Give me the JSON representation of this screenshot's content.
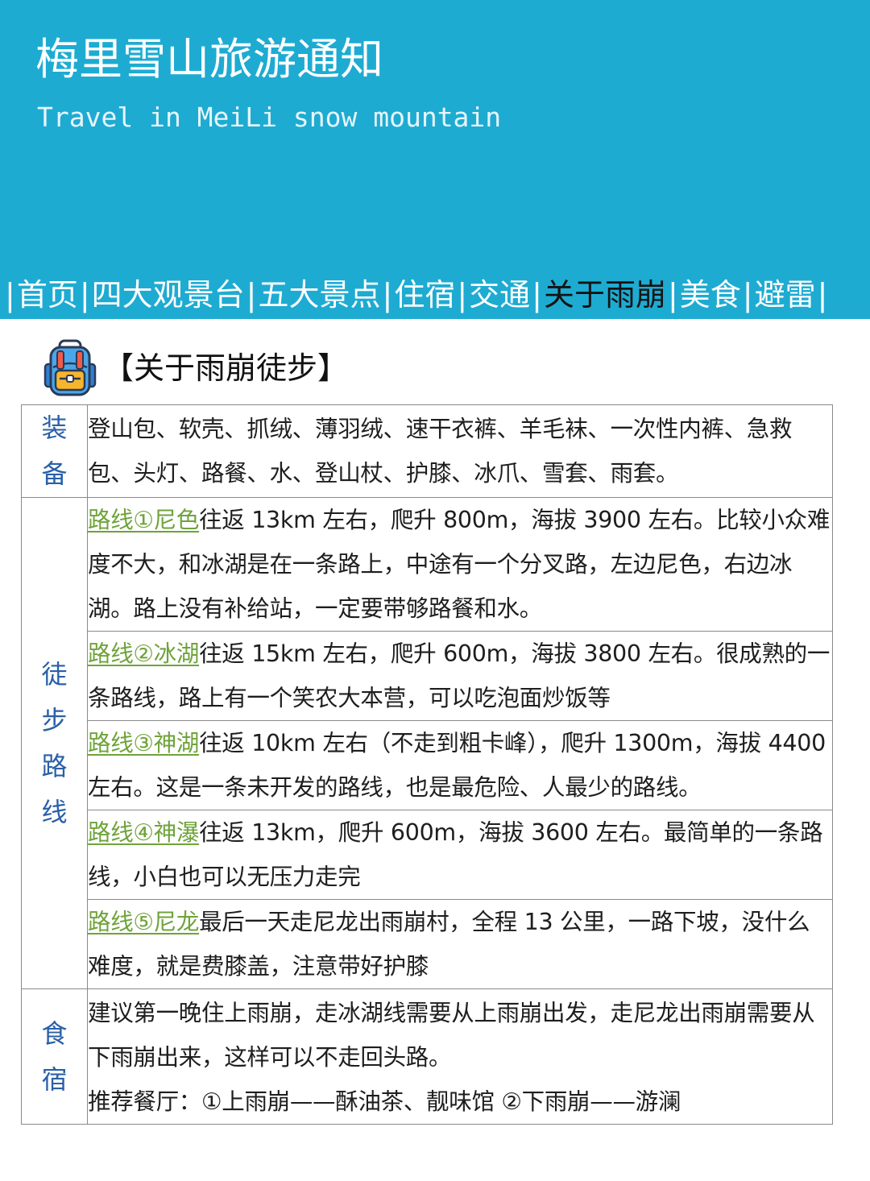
{
  "header": {
    "title": "梅里雪山旅游通知",
    "subtitle": "Travel in MeiLi snow mountain"
  },
  "nav": {
    "separator": "|",
    "items": [
      "首页",
      "四大观景台",
      "五大景点",
      "住宿",
      "交通",
      "关于雨崩",
      "美食",
      "避雷"
    ],
    "active": "关于雨崩",
    "colors": {
      "banner": "#1eabd2",
      "text": "#ffffff",
      "active": "#141414"
    }
  },
  "section": {
    "icon": "backpack-icon",
    "title": "【关于雨崩徒步】"
  },
  "table": {
    "equipment": {
      "label": [
        "装",
        "备"
      ],
      "text": "登山包、软壳、抓绒、薄羽绒、速干衣裤、羊毛袜、一次性内裤、急救包、头灯、路餐、水、登山杖、护膝、冰爪、雪套、雨套。"
    },
    "routes": {
      "label": [
        "徒",
        "步",
        "路",
        "线"
      ],
      "items": [
        {
          "tag": "路线①尼色",
          "text": "往返 13km 左右，爬升 800m，海拔 3900 左右。比较小众难度不大，和冰湖是在一条路上，中途有一个分叉路，左边尼色，右边冰湖。路上没有补给站，一定要带够路餐和水。"
        },
        {
          "tag": "路线②冰湖",
          "text": "往返 15km 左右，爬升 600m，海拔 3800 左右。很成熟的一条路线，路上有一个笑农大本营，可以吃泡面炒饭等"
        },
        {
          "tag": "路线③神湖",
          "text": "往返 10km 左右（不走到粗卡峰），爬升 1300m，海拔 4400 左右。这是一条未开发的路线，也是最危险、人最少的路线。"
        },
        {
          "tag": "路线④神瀑",
          "text": "往返 13km，爬升 600m，海拔 3600 左右。最简单的一条路线，小白也可以无压力走完"
        },
        {
          "tag": "路线⑤尼龙",
          "text": "最后一天走尼龙出雨崩村，全程 13 公里，一路下坡，没什么难度，就是费膝盖，注意带好护膝"
        }
      ]
    },
    "lodging": {
      "label": [
        "食",
        "宿"
      ],
      "text": "建议第一晚住上雨崩，走冰湖线需要从上雨崩出发，走尼龙出雨崩需要从下雨崩出来，这样可以不走回头路。",
      "restaurants": "推荐餐厅：①上雨崩——酥油茶、靓味馆 ②下雨崩——游澜"
    }
  }
}
